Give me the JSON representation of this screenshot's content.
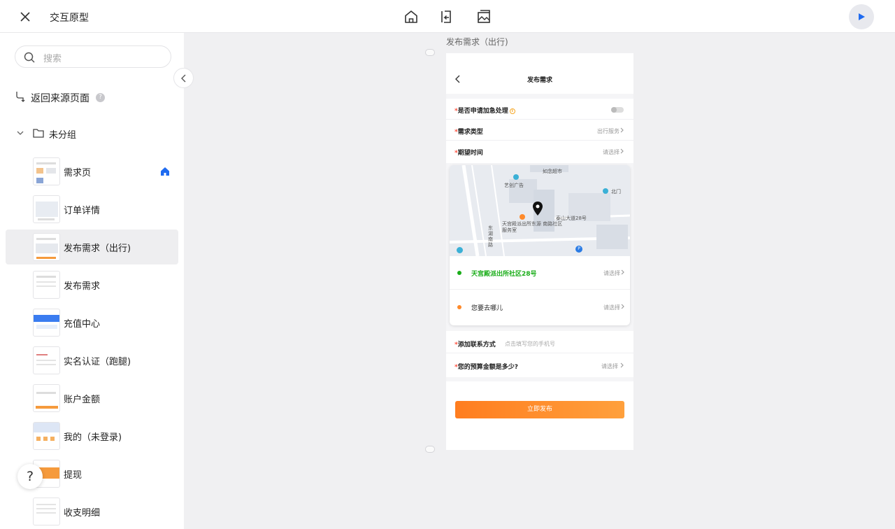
{
  "app": {
    "title": "交互原型"
  },
  "colors": {
    "accent": "#1f6bf0",
    "orange": "#ff8a2a",
    "green": "#1aad19"
  },
  "sidebar": {
    "search_placeholder": "搜索",
    "return_label": "返回来源页面",
    "group_label": "未分组",
    "pages": [
      {
        "label": "需求页",
        "home": true
      },
      {
        "label": "订单详情"
      },
      {
        "label": "发布需求（出行)",
        "active": true
      },
      {
        "label": "发布需求"
      },
      {
        "label": "充值中心"
      },
      {
        "label": "实名认证（跑腿)"
      },
      {
        "label": "账户金额"
      },
      {
        "label": "我的（未登录)"
      },
      {
        "label": "提现"
      },
      {
        "label": "收支明细"
      }
    ]
  },
  "canvas": {
    "page_title": "发布需求（出行)"
  },
  "phone": {
    "nav_title": "发布需求",
    "urgent_label": "是否申请加急处理",
    "type_label": "需求类型",
    "type_value": "出行服务",
    "time_label": "期望时间",
    "time_value": "请选择",
    "map_labels": {
      "supermarket": "如念超市",
      "ad": "艺创广告",
      "north_gate": "北门",
      "road": "泰山大道28号",
      "office": "天宫殿派出所东源 南路社区服务室",
      "street": "东湖南路"
    },
    "from_address": "天宫殿派出所社区28号",
    "from_value": "请选择",
    "to_label": "您要去哪儿",
    "to_value": "请选择",
    "contact_label": "添加联系方式",
    "contact_hint": "点击填写您的手机号",
    "budget_label": "您的预算金额是多少?",
    "budget_value": "请选择",
    "submit_label": "立即发布"
  }
}
